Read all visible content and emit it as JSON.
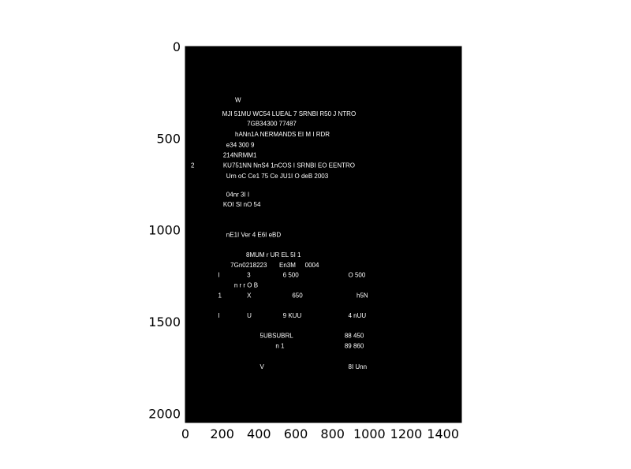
{
  "chart_data": {
    "type": "image",
    "xlim": [
      0,
      1500
    ],
    "ylim": [
      0,
      2050
    ],
    "y_axis_inverted": true,
    "x_ticks": [
      0,
      200,
      400,
      600,
      800,
      1000,
      1200,
      1400
    ],
    "y_ticks": [
      0,
      500,
      1000,
      1500,
      2000
    ],
    "x_tick_labels": [
      "0",
      "200",
      "400",
      "600",
      "800",
      "1000",
      "1200",
      "1400"
    ],
    "y_tick_labels": [
      "0",
      "500",
      "1000",
      "1500",
      "2000"
    ],
    "image_background": "#000000",
    "text_color": "#ffffff",
    "texts": [
      {
        "text": "W",
        "x": 270,
        "y": 290
      },
      {
        "text": "MJI 51MU WC54  LUEAL  7   SRNBI R50  J  NTRO",
        "x": 200,
        "y": 365
      },
      {
        "text": "7GB34300  77487",
        "x": 335,
        "y": 420
      },
      {
        "text": "hANn1A  NERMANDS EI M I RDR",
        "x": 270,
        "y": 477
      },
      {
        "text": "e34  300  9",
        "x": 222,
        "y": 534
      },
      {
        "text": "214NRMM1",
        "x": 205,
        "y": 590
      },
      {
        "text": "2",
        "x": 30,
        "y": 647
      },
      {
        "text": "KU751NN  NnS4  1nCOS  I   SRNBI   EO  EENTRO",
        "x": 205,
        "y": 647
      },
      {
        "text": "Urn  oC  Ce1  75  Ce  JU1I O  deB  2003",
        "x": 222,
        "y": 705
      },
      {
        "text": "04nr  3I I",
        "x": 222,
        "y": 805
      },
      {
        "text": "KOI SI nO  54",
        "x": 205,
        "y": 860
      },
      {
        "text": "nE1I Ver 4  E6I eBD",
        "x": 222,
        "y": 1025
      },
      {
        "text": "8MUM r UR  EL  5I 1",
        "x": 330,
        "y": 1135
      },
      {
        "text": "7Gn0218223",
        "x": 245,
        "y": 1190
      },
      {
        "text": "En3M",
        "x": 510,
        "y": 1190
      },
      {
        "text": "0004",
        "x": 650,
        "y": 1190
      },
      {
        "text": "I",
        "x": 178,
        "y": 1245
      },
      {
        "text": "3",
        "x": 335,
        "y": 1245
      },
      {
        "text": "6  500",
        "x": 530,
        "y": 1245
      },
      {
        "text": "O  500",
        "x": 885,
        "y": 1245
      },
      {
        "text": "n r r O B",
        "x": 265,
        "y": 1300
      },
      {
        "text": "1",
        "x": 178,
        "y": 1355
      },
      {
        "text": "X",
        "x": 335,
        "y": 1355
      },
      {
        "text": "650",
        "x": 580,
        "y": 1355
      },
      {
        "text": "h5N",
        "x": 930,
        "y": 1355
      },
      {
        "text": "I",
        "x": 178,
        "y": 1465
      },
      {
        "text": "U",
        "x": 335,
        "y": 1465
      },
      {
        "text": "9  KUU",
        "x": 530,
        "y": 1465
      },
      {
        "text": "4  nUU",
        "x": 885,
        "y": 1465
      },
      {
        "text": "5UBSUBRL",
        "x": 405,
        "y": 1575
      },
      {
        "text": "88  450",
        "x": 865,
        "y": 1575
      },
      {
        "text": "n  1",
        "x": 490,
        "y": 1630
      },
      {
        "text": "89  860",
        "x": 865,
        "y": 1630
      },
      {
        "text": "V",
        "x": 405,
        "y": 1745
      },
      {
        "text": "8I  Unn",
        "x": 885,
        "y": 1745
      }
    ]
  }
}
